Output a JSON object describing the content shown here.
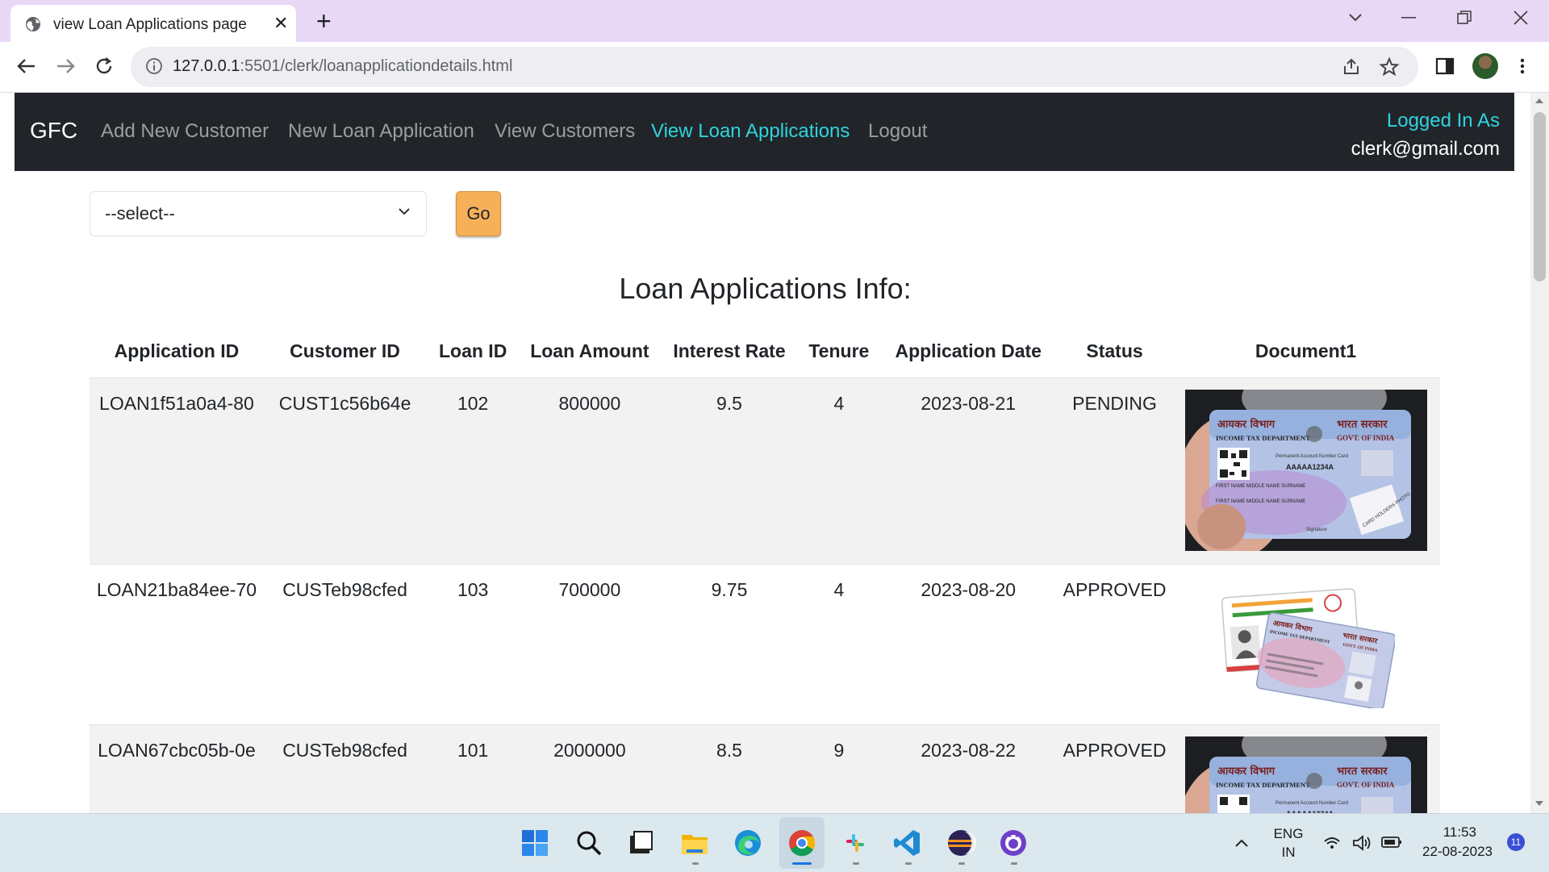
{
  "browser": {
    "tab_title": "view Loan Applications page",
    "url_host": "127.0.0.1",
    "url_rest": ":5501/clerk/loanapplicationdetails.html"
  },
  "navbar": {
    "brand": "GFC",
    "links": [
      "Add New Customer",
      "New Loan Application",
      "View Customers",
      "View Loan Applications",
      "Logout"
    ],
    "active": "View Loan Applications",
    "logged_in_label": "Logged In As",
    "logged_in_email": "clerk@gmail.com"
  },
  "filter": {
    "select_value": "--select--",
    "go_label": "Go"
  },
  "heading": "Loan Applications Info:",
  "table": {
    "headers": [
      "Application ID",
      "Customer ID",
      "Loan ID",
      "Loan Amount",
      "Interest Rate",
      "Tenure",
      "Application Date",
      "Status",
      "Document1"
    ],
    "rows": [
      {
        "application_id": "LOAN1f51a0a4-80",
        "customer_id": "CUST1c56b64e",
        "loan_id": "102",
        "loan_amount": "800000",
        "interest_rate": "9.5",
        "tenure": "4",
        "application_date": "2023-08-21",
        "status": "PENDING",
        "document": "pan-card-photo"
      },
      {
        "application_id": "LOAN21ba84ee-70",
        "customer_id": "CUSTeb98cfed",
        "loan_id": "103",
        "loan_amount": "700000",
        "interest_rate": "9.75",
        "tenure": "4",
        "application_date": "2023-08-20",
        "status": "APPROVED",
        "document": "aadhaar-pan-illustration"
      },
      {
        "application_id": "LOAN67cbc05b-0e",
        "customer_id": "CUSTeb98cfed",
        "loan_id": "101",
        "loan_amount": "2000000",
        "interest_rate": "8.5",
        "tenure": "9",
        "application_date": "2023-08-22",
        "status": "APPROVED",
        "document": "pan-card-photo"
      }
    ]
  },
  "doc_text": {
    "hindi_left": "आयकर विभाग",
    "hindi_right": "भारत सरकार",
    "dept": "INCOME TAX DEPARTMENT",
    "govt": "GOVT. OF INDIA",
    "pan_label": "Permanent Account Number Card",
    "pan_number": "AAAAA1234A",
    "name_line": "FIRST NAME MIDDLE NAME SURNAME",
    "photo_label": "CARD HOLDERS PHOTO",
    "signature": "Signature"
  },
  "taskbar": {
    "apps": [
      "windows-start-icon",
      "search-icon",
      "task-view-icon",
      "file-explorer-icon",
      "edge-icon",
      "chrome-icon",
      "slack-icon",
      "vscode-icon",
      "eclipse-icon",
      "github-desktop-icon"
    ],
    "lang_top": "ENG",
    "lang_bottom": "IN",
    "time": "11:53",
    "date": "22-08-2023",
    "notifications": "11"
  }
}
